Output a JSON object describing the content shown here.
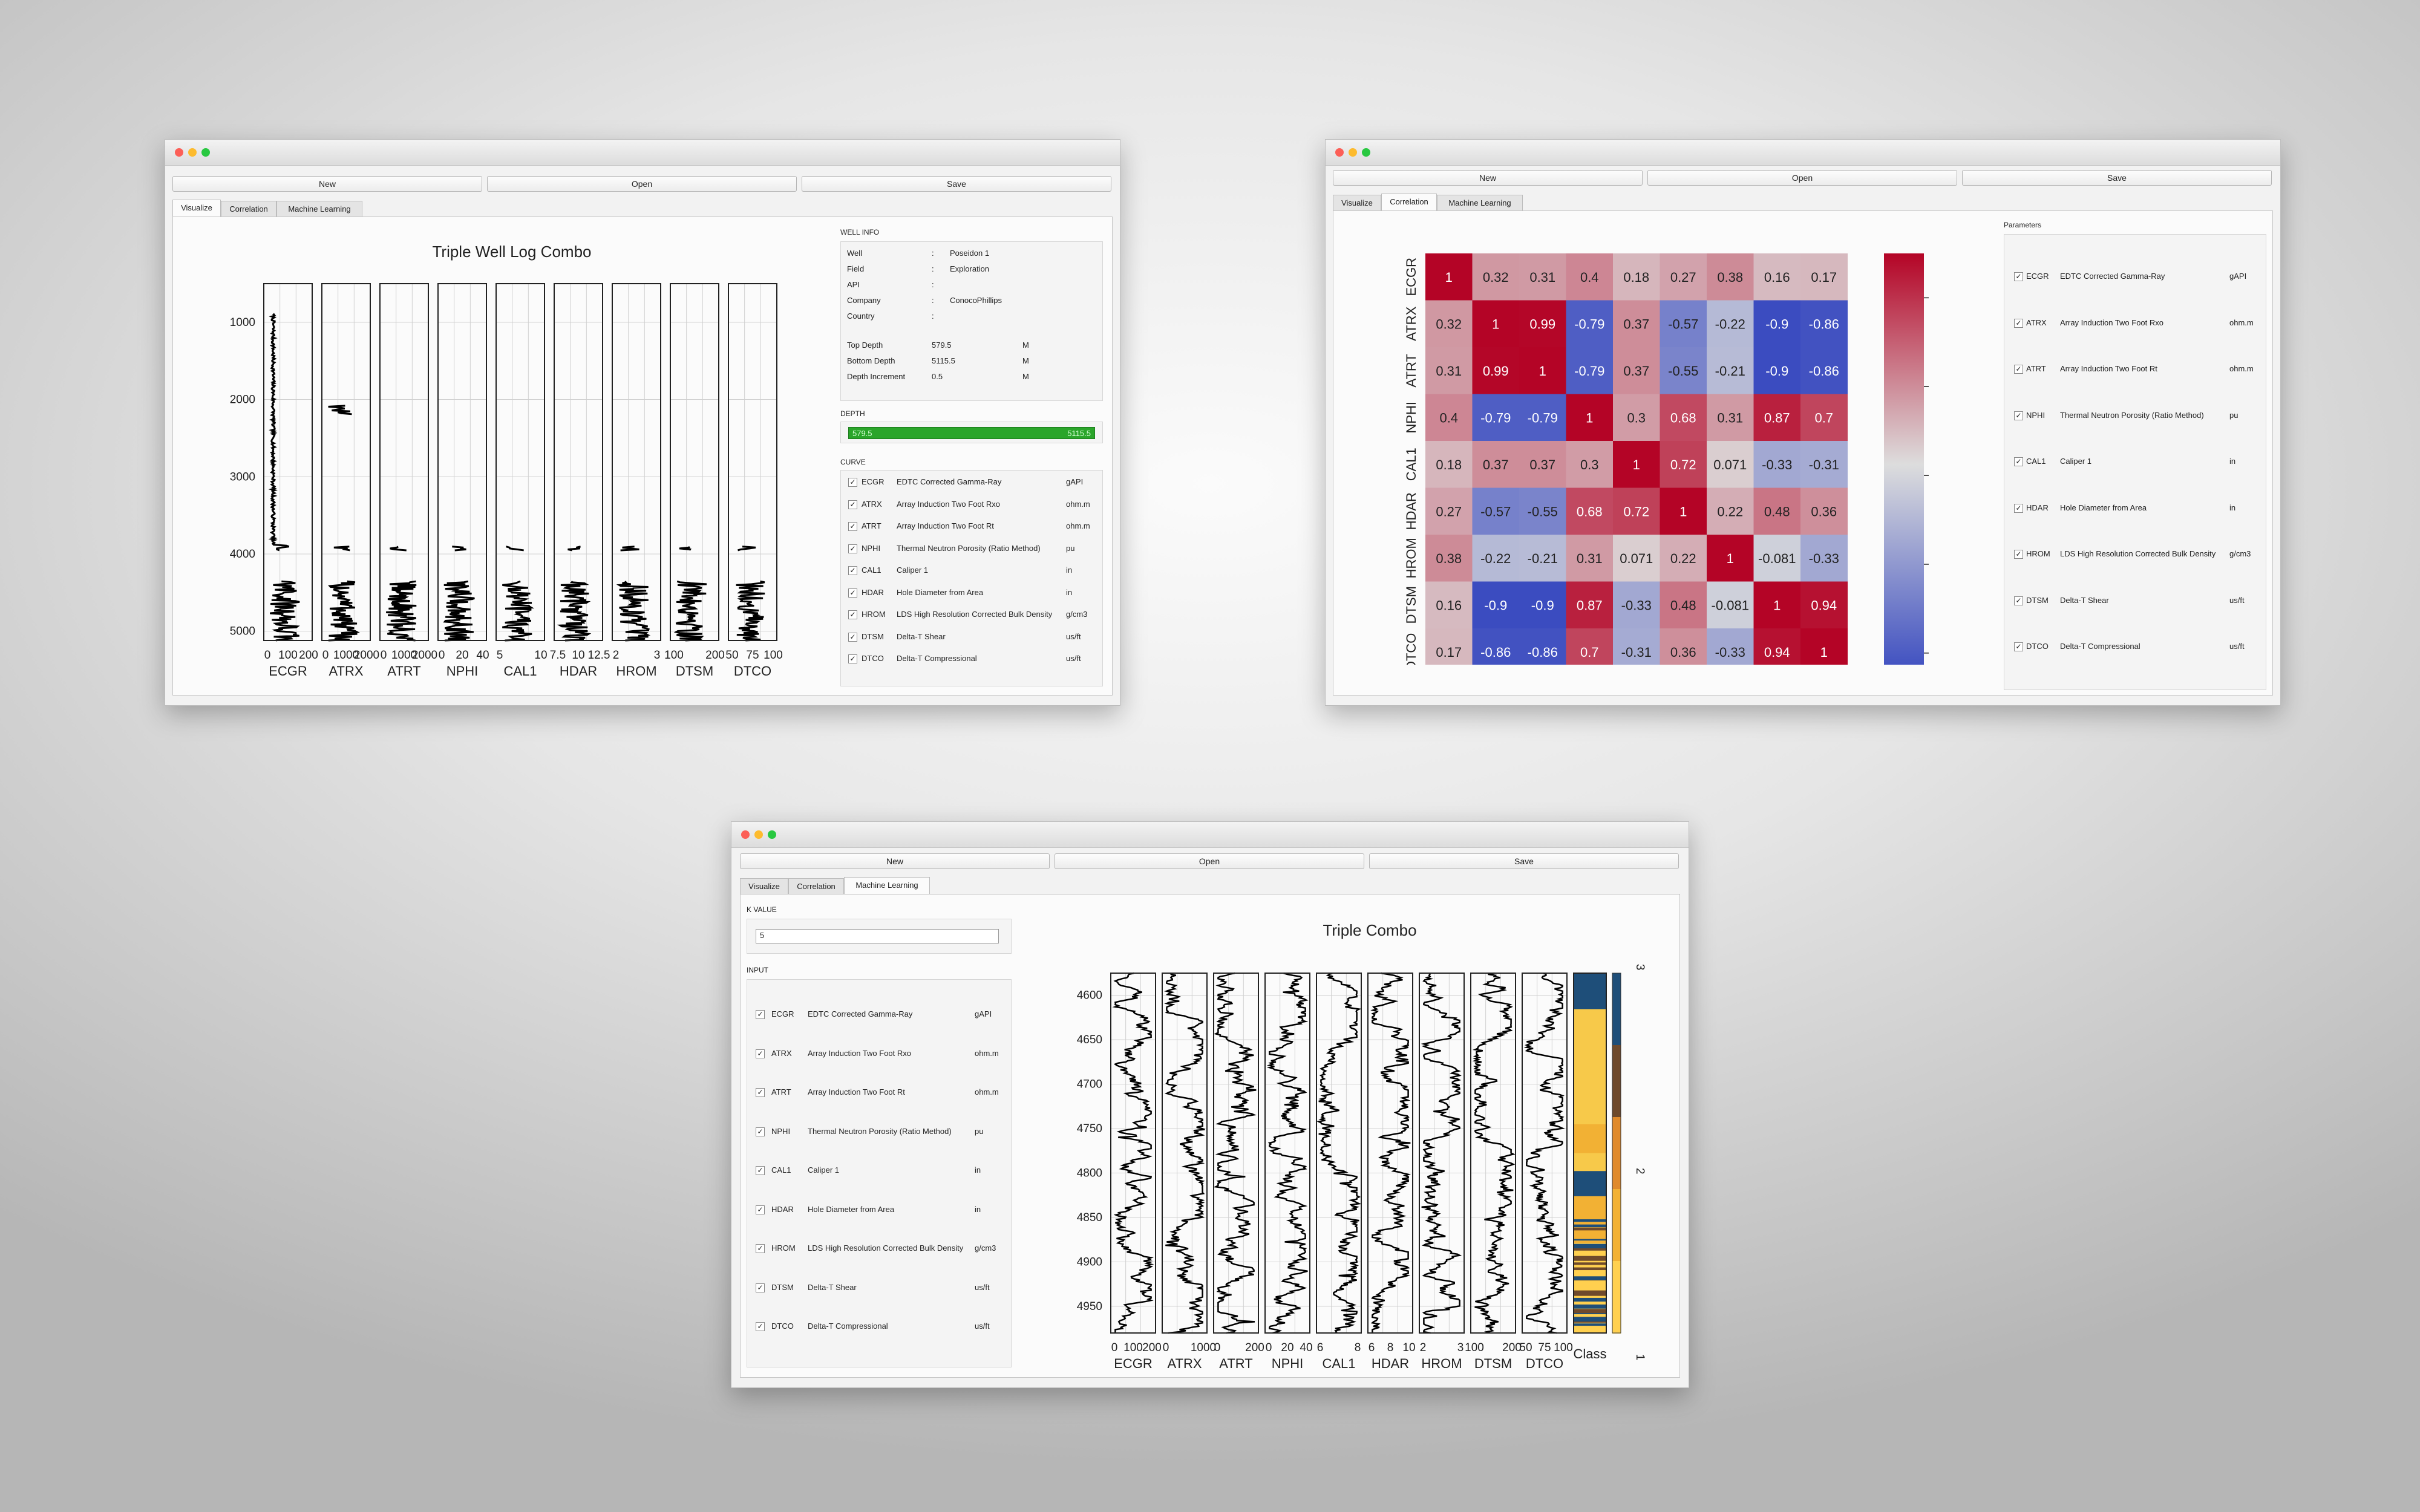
{
  "toolbar": {
    "new": "New",
    "open": "Open",
    "save": "Save"
  },
  "tabs": {
    "visualize": "Visualize",
    "correlation": "Correlation",
    "ml": "Machine Learning"
  },
  "curves": [
    {
      "mnemonic": "ECGR",
      "desc": "EDTC Corrected Gamma-Ray",
      "unit": "gAPI"
    },
    {
      "mnemonic": "ATRX",
      "desc": "Array Induction Two Foot Rxo",
      "unit": "ohm.m"
    },
    {
      "mnemonic": "ATRT",
      "desc": "Array Induction Two Foot Rt",
      "unit": "ohm.m"
    },
    {
      "mnemonic": "NPHI",
      "desc": "Thermal Neutron Porosity (Ratio Method)",
      "unit": "pu"
    },
    {
      "mnemonic": "CAL1",
      "desc": "Caliper 1",
      "unit": "in"
    },
    {
      "mnemonic": "HDAR",
      "desc": "Hole Diameter from Area",
      "unit": "in"
    },
    {
      "mnemonic": "HROM",
      "desc": "LDS High Resolution Corrected Bulk Density",
      "unit": "g/cm3"
    },
    {
      "mnemonic": "DTSM",
      "desc": "Delta-T Shear",
      "unit": "us/ft"
    },
    {
      "mnemonic": "DTCO",
      "desc": "Delta-T Compressional",
      "unit": "us/ft"
    }
  ],
  "checkmark": "✓",
  "visualize": {
    "well_info_label": "WELL INFO",
    "well_info": [
      {
        "k": "Well",
        "sep": ":",
        "v": "Poseidon 1",
        "u": ""
      },
      {
        "k": "Field",
        "sep": ":",
        "v": "Exploration",
        "u": ""
      },
      {
        "k": "API",
        "sep": ":",
        "v": "",
        "u": ""
      },
      {
        "k": "Company",
        "sep": ":",
        "v": "ConocoPhillips",
        "u": ""
      },
      {
        "k": "Country",
        "sep": ":",
        "v": "",
        "u": ""
      },
      {
        "k": "Top Depth",
        "sep": "",
        "v": "579.5",
        "u": "M"
      },
      {
        "k": "Bottom Depth",
        "sep": "",
        "v": "5115.5",
        "u": "M"
      },
      {
        "k": "Depth Increment",
        "sep": "",
        "v": "0.5",
        "u": "M"
      }
    ],
    "depth_label": "DEPTH",
    "depth_min": "579.5",
    "depth_max": "5115.5",
    "curve_label": "CURVE"
  },
  "parameters_label": "Parameters",
  "ml": {
    "k_label": "K VALUE",
    "k_value": "5",
    "input_label": "INPUT"
  },
  "chart_data": [
    {
      "type": "line",
      "title": "Triple Well Log Combo",
      "y_ticks": [
        "1000",
        "2000",
        "3000",
        "4000",
        "5000"
      ],
      "ylim": [
        5120,
        500
      ],
      "tracks": [
        {
          "name": "ECGR",
          "ticks": [
            "0",
            "100",
            "200"
          ]
        },
        {
          "name": "ATRX",
          "ticks": [
            "0",
            "1000",
            "2000"
          ]
        },
        {
          "name": "ATRT",
          "ticks": [
            "0",
            "1000",
            "2000"
          ]
        },
        {
          "name": "NPHI",
          "ticks": [
            "0",
            "20",
            "40"
          ]
        },
        {
          "name": "CAL1",
          "ticks": [
            "5",
            "10"
          ]
        },
        {
          "name": "HDAR",
          "ticks": [
            "7.5",
            "10",
            "12.5"
          ]
        },
        {
          "name": "HROM",
          "ticks": [
            "2",
            "3"
          ]
        },
        {
          "name": "DTSM",
          "ticks": [
            "100",
            "200"
          ]
        },
        {
          "name": "DTCO",
          "ticks": [
            "50",
            "75",
            "100"
          ]
        }
      ]
    },
    {
      "type": "heatmap",
      "labels": [
        "ECGR",
        "ATRX",
        "ATRT",
        "NPHI",
        "CAL1",
        "HDAR",
        "HROM",
        "DTSM",
        "DTCO"
      ],
      "matrix": [
        [
          1,
          0.32,
          0.31,
          0.4,
          0.18,
          0.27,
          0.38,
          0.16,
          0.17
        ],
        [
          0.32,
          1,
          0.99,
          -0.79,
          0.37,
          -0.57,
          -0.22,
          -0.9,
          -0.86
        ],
        [
          0.31,
          0.99,
          1,
          -0.79,
          0.37,
          -0.55,
          -0.21,
          -0.9,
          -0.86
        ],
        [
          0.4,
          -0.79,
          -0.79,
          1,
          0.3,
          0.68,
          0.31,
          0.87,
          0.7
        ],
        [
          0.18,
          0.37,
          0.37,
          0.3,
          1,
          0.72,
          0.071,
          -0.33,
          -0.31
        ],
        [
          0.27,
          -0.57,
          -0.55,
          0.68,
          0.72,
          1,
          0.22,
          0.48,
          0.36
        ],
        [
          0.38,
          -0.22,
          -0.21,
          0.31,
          0.071,
          0.22,
          1,
          -0.081,
          -0.33
        ],
        [
          0.16,
          -0.9,
          -0.9,
          0.87,
          -0.33,
          0.48,
          -0.081,
          1,
          0.94
        ],
        [
          0.17,
          -0.86,
          -0.86,
          0.7,
          -0.31,
          0.36,
          -0.33,
          0.94,
          1
        ]
      ],
      "colorbar_ticks": [
        "0.8",
        "0.4",
        "0.0",
        "−0.4",
        "−0.8"
      ],
      "vmin": -0.9,
      "vmax": 1
    },
    {
      "type": "line",
      "title": "Triple Combo",
      "y_ticks": [
        "4600",
        "4650",
        "4700",
        "4750",
        "4800",
        "4850",
        "4900",
        "4950"
      ],
      "ylim": [
        4980,
        4575
      ],
      "tracks": [
        {
          "name": "ECGR",
          "ticks": [
            "0",
            "100",
            "200"
          ]
        },
        {
          "name": "ATRX",
          "ticks": [
            "0",
            "1000"
          ]
        },
        {
          "name": "ATRT",
          "ticks": [
            "0",
            "200"
          ]
        },
        {
          "name": "NPHI",
          "ticks": [
            "0",
            "20",
            "40"
          ]
        },
        {
          "name": "CAL1",
          "ticks": [
            "6",
            "8"
          ]
        },
        {
          "name": "HDAR",
          "ticks": [
            "6",
            "8",
            "10"
          ]
        },
        {
          "name": "HROM",
          "ticks": [
            "2",
            "3"
          ]
        },
        {
          "name": "DTSM",
          "ticks": [
            "100",
            "200"
          ]
        },
        {
          "name": "DTCO",
          "ticks": [
            "50",
            "75",
            "100"
          ]
        }
      ],
      "class_label": "Class",
      "class_colorbar_ticks": [
        "3",
        "2",
        "1"
      ]
    }
  ]
}
